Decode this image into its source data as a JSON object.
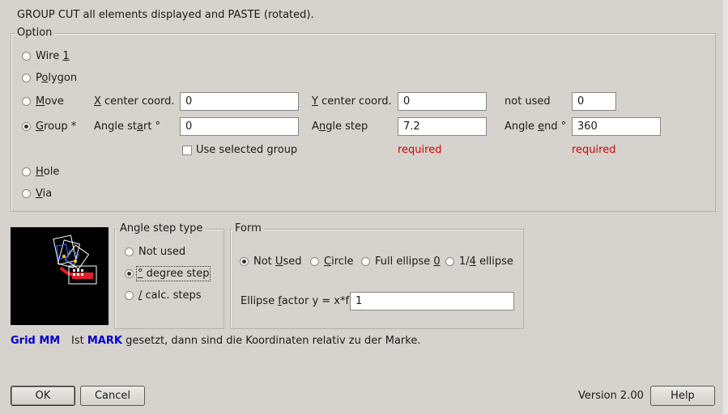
{
  "header": {
    "description": "GROUP CUT all elements displayed and PASTE (rotated)."
  },
  "option": {
    "title": "Option",
    "radios": {
      "wire": {
        "pre": "Wire ",
        "u": "1",
        "post": "",
        "checked": false
      },
      "polygon": {
        "pre": "P",
        "u": "o",
        "post": "lygon",
        "checked": false
      },
      "move": {
        "pre": "",
        "u": "M",
        "post": "ove",
        "checked": false
      },
      "group": {
        "pre": "",
        "u": "G",
        "post": "roup *",
        "checked": true
      },
      "hole": {
        "pre": "",
        "u": "H",
        "post": "ole",
        "checked": false
      },
      "via": {
        "pre": "",
        "u": "V",
        "post": "ia",
        "checked": false
      }
    },
    "row_move": {
      "x_label": {
        "pre": "",
        "u": "X",
        "post": " center coord."
      },
      "x_value": "0",
      "y_label": {
        "pre": "",
        "u": "Y",
        "post": " center coord."
      },
      "y_value": "0",
      "third_label": "not used",
      "third_value": "0"
    },
    "row_group": {
      "start_label": {
        "pre": "Angle st",
        "u": "a",
        "post": "rt °"
      },
      "start_value": "0",
      "step_label": {
        "pre": "A",
        "u": "n",
        "post": "gle step"
      },
      "step_value": "7.2",
      "end_label": {
        "pre": "Angle ",
        "u": "e",
        "post": "nd °"
      },
      "end_value": "360"
    },
    "use_selected_group": {
      "label": "Use selected group",
      "checked": false
    },
    "required_step": "required",
    "required_end": "required"
  },
  "angle_step_type": {
    "title": "Angle step type",
    "not_used": {
      "pre": "Not used",
      "u": "",
      "post": "",
      "checked": false
    },
    "degree_step": {
      "pre": "",
      "u": "°",
      "post": " degree step",
      "checked": true
    },
    "calc_steps": {
      "pre": "",
      "u": "/",
      "post": " calc. steps",
      "checked": false
    }
  },
  "form": {
    "title": "Form",
    "not_used": {
      "pre": "Not ",
      "u": "U",
      "post": "sed",
      "checked": true
    },
    "circle": {
      "pre": "",
      "u": "C",
      "post": "ircle",
      "checked": false
    },
    "full_ellipse": {
      "pre": "Full ellipse ",
      "u": "0",
      "post": "",
      "checked": false
    },
    "quarter_ellipse": {
      "pre": "1/",
      "u": "4",
      "post": " ellipse",
      "checked": false
    },
    "factor_label": {
      "pre": "Ellipse ",
      "u": "f",
      "post": "actor y = x*f"
    },
    "factor_value": "1"
  },
  "info": {
    "grid": "Grid MM",
    "pre": "Ist ",
    "mark": "MARK",
    "post": " gesetzt, dann sind die Koordinaten relativ zu der Marke."
  },
  "footer": {
    "ok": "OK",
    "cancel": "Cancel",
    "version": "Version 2.00",
    "help": "Help"
  },
  "colors": {
    "background": "#d6d3ce",
    "required": "#d40000",
    "info_blue": "#0000c8"
  }
}
